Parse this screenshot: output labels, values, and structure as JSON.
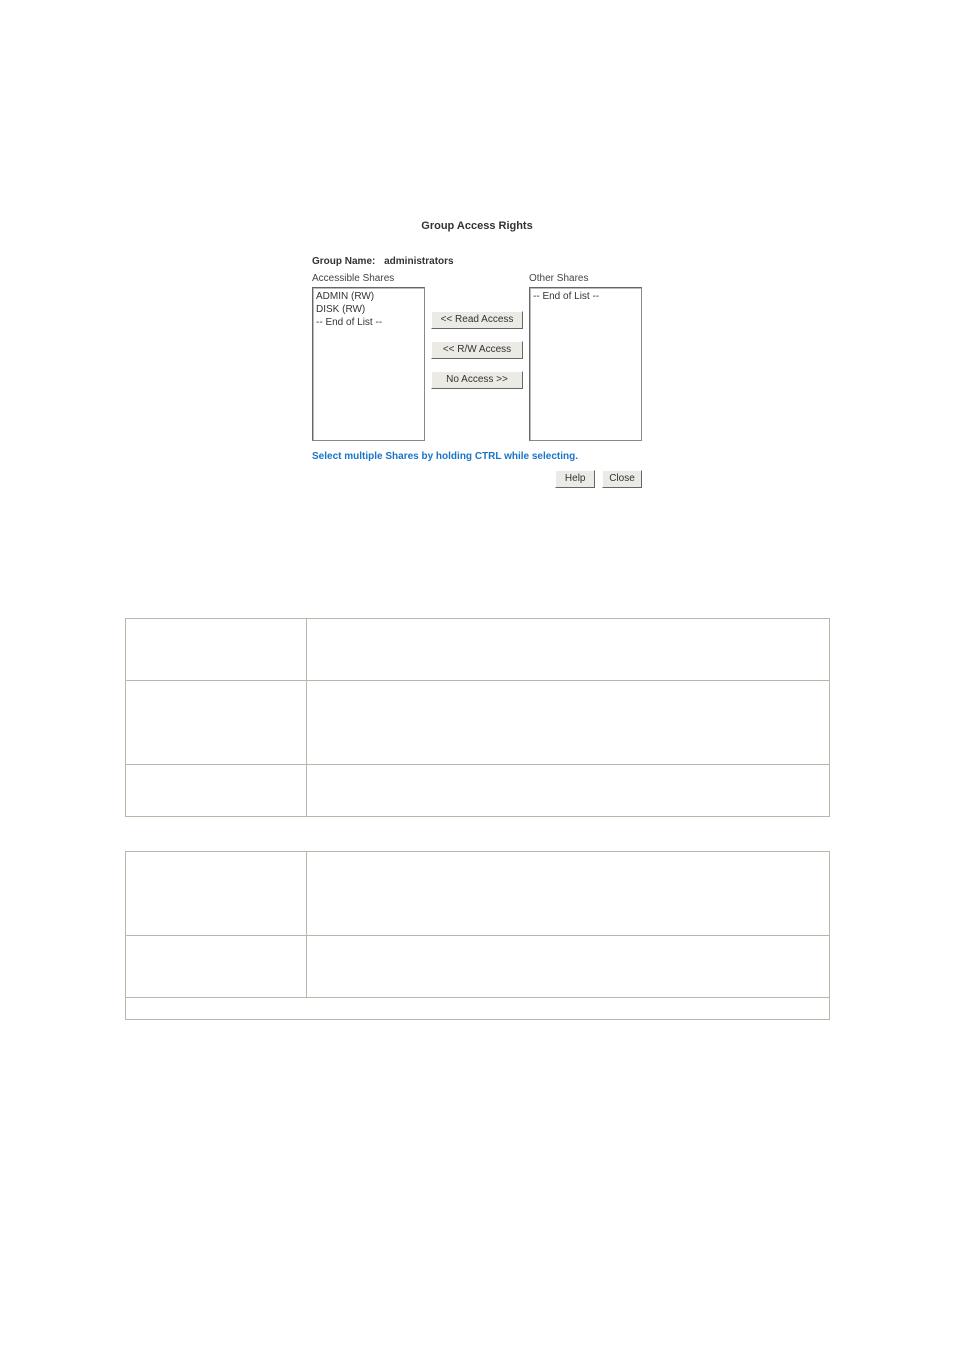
{
  "dialog": {
    "title": "Group Access Rights",
    "group_name_label": "Group Name:",
    "group_name_value": "administrators",
    "accessible_label": "Accessible Shares",
    "other_label": "Other Shares",
    "accessible_items": [
      "ADMIN (RW)",
      "DISK (RW)",
      "-- End of List --"
    ],
    "other_items": [
      "-- End of List --"
    ],
    "buttons": {
      "read": "<< Read Access",
      "rw": "<< R/W Access",
      "noaccess": "No Access >>"
    },
    "hint": "Select multiple Shares by holding CTRL while selecting.",
    "help": "Help",
    "close": "Close"
  }
}
